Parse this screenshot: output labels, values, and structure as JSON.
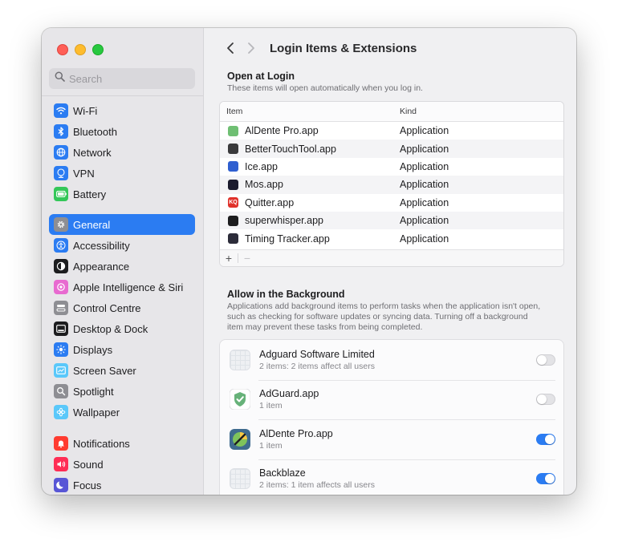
{
  "window": {
    "title": "Login Items & Extensions"
  },
  "sidebar": {
    "search_placeholder": "Search",
    "groups": [
      [
        {
          "label": "Wi-Fi",
          "icon": "wifi-icon",
          "color": "#2b7cf2"
        },
        {
          "label": "Bluetooth",
          "icon": "bluetooth-icon",
          "color": "#2b7cf2"
        },
        {
          "label": "Network",
          "icon": "globe-icon",
          "color": "#2b7cf2"
        },
        {
          "label": "VPN",
          "icon": "vpn-icon",
          "color": "#2b7cf2"
        },
        {
          "label": "Battery",
          "icon": "battery-icon",
          "color": "#34c759"
        }
      ],
      [
        {
          "label": "General",
          "icon": "gear-icon",
          "color": "#8e8e93",
          "selected": true
        },
        {
          "label": "Accessibility",
          "icon": "accessibility-icon",
          "color": "#2b7cf2"
        },
        {
          "label": "Appearance",
          "icon": "appearance-icon",
          "color": "#1d1d1f"
        },
        {
          "label": "Apple Intelligence & Siri",
          "icon": "siri-icon",
          "color": "#e86ad0"
        },
        {
          "label": "Control Centre",
          "icon": "control-centre-icon",
          "color": "#8e8e93"
        },
        {
          "label": "Desktop & Dock",
          "icon": "dock-icon",
          "color": "#1d1d1f"
        },
        {
          "label": "Displays",
          "icon": "displays-icon",
          "color": "#2b7cf2"
        },
        {
          "label": "Screen Saver",
          "icon": "screen-saver-icon",
          "color": "#5ac8fa"
        },
        {
          "label": "Spotlight",
          "icon": "spotlight-icon",
          "color": "#8e8e93"
        },
        {
          "label": "Wallpaper",
          "icon": "wallpaper-icon",
          "color": "#5ac8fa"
        }
      ],
      [
        {
          "label": "Notifications",
          "icon": "notifications-icon",
          "color": "#ff3b30"
        },
        {
          "label": "Sound",
          "icon": "sound-icon",
          "color": "#ff2d55"
        },
        {
          "label": "Focus",
          "icon": "focus-icon",
          "color": "#5856d6"
        }
      ]
    ]
  },
  "open_at_login": {
    "title": "Open at Login",
    "subtitle": "These items will open automatically when you log in.",
    "col_item": "Item",
    "col_kind": "Kind",
    "add_label": "+",
    "remove_label": "−",
    "rows": [
      {
        "name": "AlDente Pro.app",
        "kind": "Application",
        "icon_color": "#6fbf73",
        "glyph": ""
      },
      {
        "name": "BetterTouchTool.app",
        "kind": "Application",
        "icon_color": "#3a3a3c",
        "glyph": ""
      },
      {
        "name": "Ice.app",
        "kind": "Application",
        "icon_color": "#2f5fd0",
        "glyph": ""
      },
      {
        "name": "Mos.app",
        "kind": "Application",
        "icon_color": "#1c1c2e",
        "glyph": ""
      },
      {
        "name": "Quitter.app",
        "kind": "Application",
        "icon_color": "#e0312a",
        "glyph": "KQ"
      },
      {
        "name": "superwhisper.app",
        "kind": "Application",
        "icon_color": "#1d1d1f",
        "glyph": ""
      },
      {
        "name": "Timing Tracker.app",
        "kind": "Application",
        "icon_color": "#2c2c3a",
        "glyph": ""
      }
    ]
  },
  "background": {
    "title": "Allow in the Background",
    "subtitle": "Applications add background items to perform tasks when the application isn't open, such as checking for software updates or syncing data. Turning off a background item may prevent these tasks from being completed.",
    "items": [
      {
        "name": "Adguard Software Limited",
        "detail": "2 items: 2 items affect all users",
        "enabled": false,
        "icon": "placeholder"
      },
      {
        "name": "AdGuard.app",
        "detail": "1 item",
        "enabled": false,
        "icon": "adguard"
      },
      {
        "name": "AlDente Pro.app",
        "detail": "1 item",
        "enabled": true,
        "icon": "aldente"
      },
      {
        "name": "Backblaze",
        "detail": "2 items: 1 item affects all users",
        "enabled": true,
        "icon": "placeholder"
      }
    ]
  }
}
